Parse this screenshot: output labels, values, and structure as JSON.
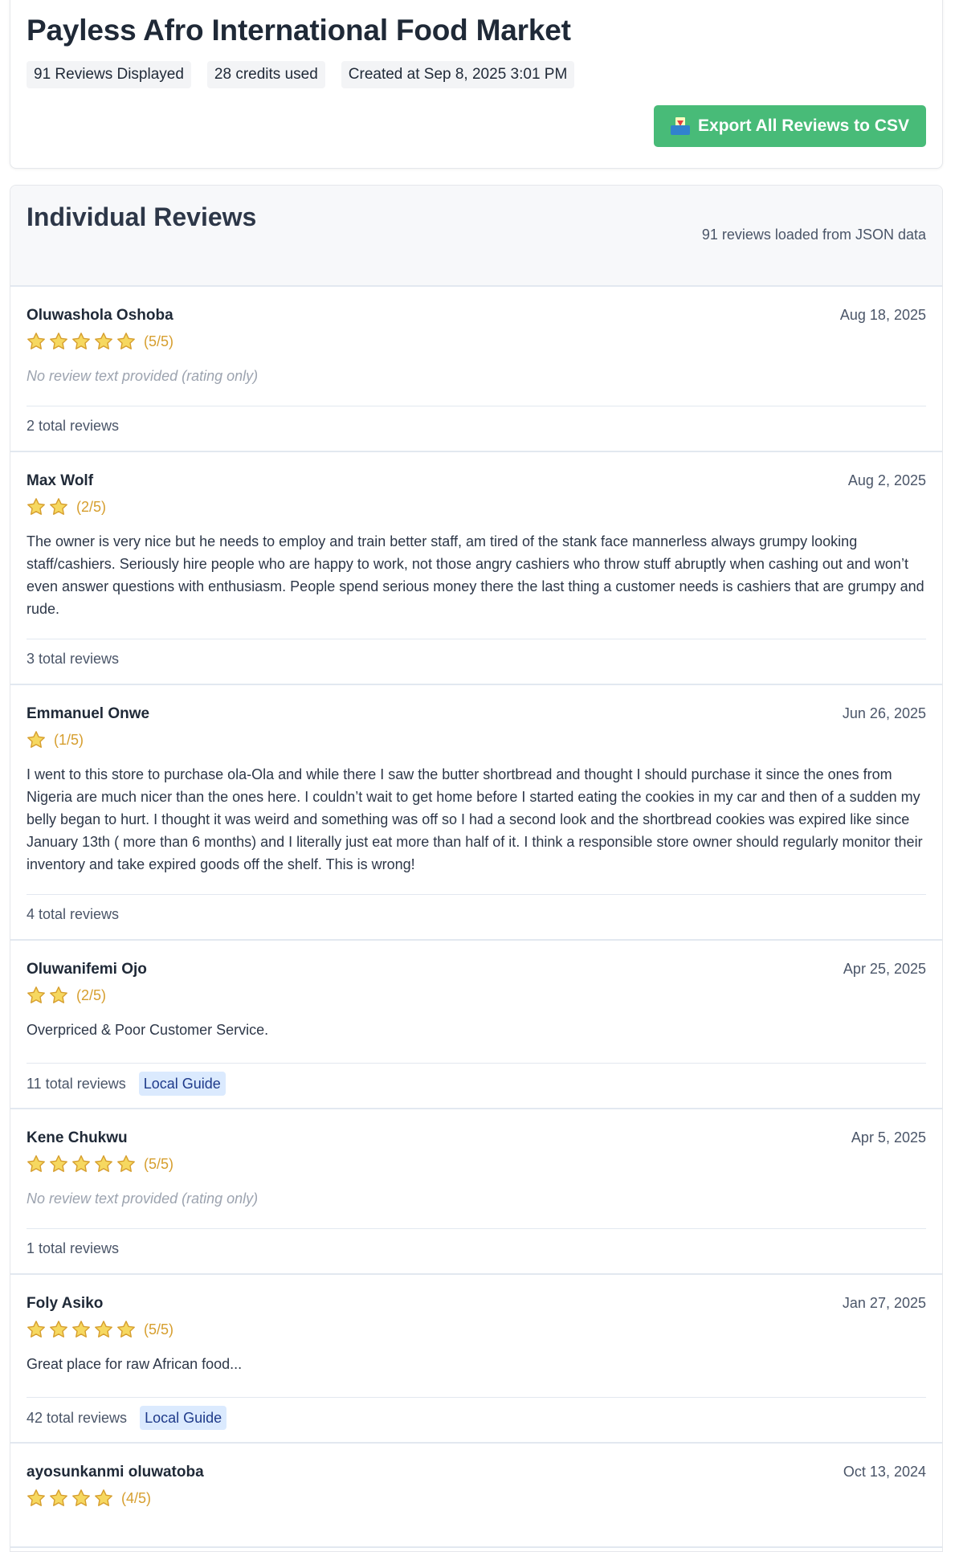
{
  "header": {
    "title": "Payless Afro International Food Market",
    "meta": [
      "91 Reviews Displayed",
      "28 credits used",
      "Created at Sep 8, 2025 3:01 PM"
    ],
    "export_label": "Export All Reviews to CSV",
    "export_icon": "inbox-tray-icon"
  },
  "reviews_section": {
    "title": "Individual Reviews",
    "loaded_note": "91 reviews loaded from JSON data"
  },
  "colors": {
    "accent_green": "#48bb78",
    "star_gold": "#d69e2e",
    "badge_bg": "#dbeafe"
  },
  "reviews": [
    {
      "name": "Oluwashola Oshoba",
      "date": "Aug 18, 2025",
      "rating": 5,
      "rating_label": "(5/5)",
      "text": "No review text provided (rating only)",
      "has_text": false,
      "total": "2 total reviews",
      "badge": ""
    },
    {
      "name": "Max Wolf",
      "date": "Aug 2, 2025",
      "rating": 2,
      "rating_label": "(2/5)",
      "text": "The owner is very nice but he needs to employ and train better staff, am tired of the stank face mannerless always grumpy looking staff/cashiers. Seriously hire people who are happy to work, not those angry cashiers who throw stuff abruptly when cashing out and won’t even answer questions with enthusiasm. People spend serious money there the last thing a customer needs is cashiers that are grumpy and rude.",
      "has_text": true,
      "total": "3 total reviews",
      "badge": ""
    },
    {
      "name": "Emmanuel Onwe",
      "date": "Jun 26, 2025",
      "rating": 1,
      "rating_label": "(1/5)",
      "text": "I went to this store to purchase ola-Ola and while there I saw the butter shortbread and thought I should purchase it since the ones from Nigeria are much nicer than the ones here. I couldn’t wait to get home before I started eating the cookies in my car and then of a sudden my belly began to hurt. I thought it was weird and something was off so I had a second look and the shortbread cookies was expired like since January 13th ( more than 6 months) and I literally just eat more than half of it. I think a responsible store owner should regularly monitor their inventory and take expired goods off the shelf. This is wrong!",
      "has_text": true,
      "total": "4 total reviews",
      "badge": ""
    },
    {
      "name": "Oluwanifemi Ojo",
      "date": "Apr 25, 2025",
      "rating": 2,
      "rating_label": "(2/5)",
      "text": "Overpriced & Poor Customer Service.",
      "has_text": true,
      "total": "11 total reviews",
      "badge": "Local Guide"
    },
    {
      "name": "Kene Chukwu",
      "date": "Apr 5, 2025",
      "rating": 5,
      "rating_label": "(5/5)",
      "text": "No review text provided (rating only)",
      "has_text": false,
      "total": "1 total reviews",
      "badge": ""
    },
    {
      "name": "Foly Asiko",
      "date": "Jan 27, 2025",
      "rating": 5,
      "rating_label": "(5/5)",
      "text": "Great place for raw African food...",
      "has_text": true,
      "total": "42 total reviews",
      "badge": "Local Guide"
    },
    {
      "name": "ayosunkanmi oluwatoba",
      "date": "Oct 13, 2024",
      "rating": 4,
      "rating_label": "(4/5)",
      "text": "",
      "has_text": true,
      "total": "",
      "badge": ""
    }
  ]
}
